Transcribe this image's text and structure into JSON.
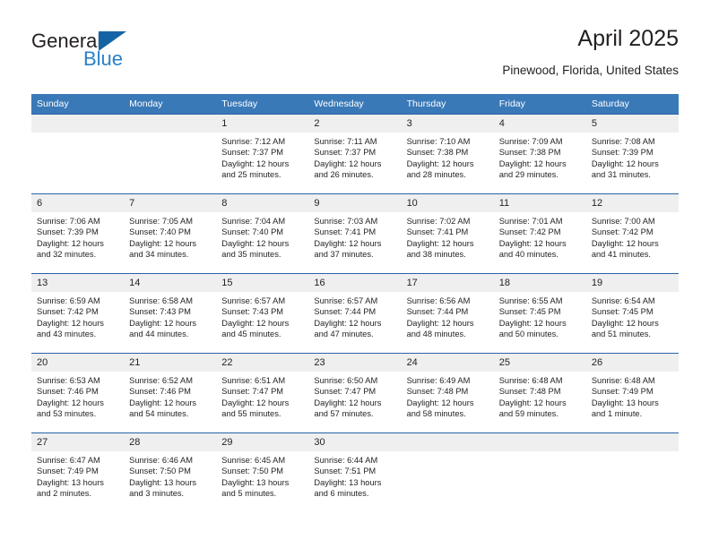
{
  "branding": {
    "logo_primary": "General",
    "logo_secondary": "Blue",
    "accent_color": "#2a7fc9",
    "triangle_color": "#1464a5"
  },
  "header": {
    "title": "April 2025",
    "subtitle": "Pinewood, Florida, United States"
  },
  "calendar": {
    "header_bg": "#3a79b8",
    "row_divider_color": "#2a62a8",
    "daynum_bg": "#efefef",
    "weekday_headers": [
      "Sunday",
      "Monday",
      "Tuesday",
      "Wednesday",
      "Thursday",
      "Friday",
      "Saturday"
    ],
    "weeks": [
      [
        {
          "day": "",
          "empty": true
        },
        {
          "day": "",
          "empty": true
        },
        {
          "day": "1",
          "sunrise": "Sunrise: 7:12 AM",
          "sunset": "Sunset: 7:37 PM",
          "daylight": "Daylight: 12 hours and 25 minutes."
        },
        {
          "day": "2",
          "sunrise": "Sunrise: 7:11 AM",
          "sunset": "Sunset: 7:37 PM",
          "daylight": "Daylight: 12 hours and 26 minutes."
        },
        {
          "day": "3",
          "sunrise": "Sunrise: 7:10 AM",
          "sunset": "Sunset: 7:38 PM",
          "daylight": "Daylight: 12 hours and 28 minutes."
        },
        {
          "day": "4",
          "sunrise": "Sunrise: 7:09 AM",
          "sunset": "Sunset: 7:38 PM",
          "daylight": "Daylight: 12 hours and 29 minutes."
        },
        {
          "day": "5",
          "sunrise": "Sunrise: 7:08 AM",
          "sunset": "Sunset: 7:39 PM",
          "daylight": "Daylight: 12 hours and 31 minutes."
        }
      ],
      [
        {
          "day": "6",
          "sunrise": "Sunrise: 7:06 AM",
          "sunset": "Sunset: 7:39 PM",
          "daylight": "Daylight: 12 hours and 32 minutes."
        },
        {
          "day": "7",
          "sunrise": "Sunrise: 7:05 AM",
          "sunset": "Sunset: 7:40 PM",
          "daylight": "Daylight: 12 hours and 34 minutes."
        },
        {
          "day": "8",
          "sunrise": "Sunrise: 7:04 AM",
          "sunset": "Sunset: 7:40 PM",
          "daylight": "Daylight: 12 hours and 35 minutes."
        },
        {
          "day": "9",
          "sunrise": "Sunrise: 7:03 AM",
          "sunset": "Sunset: 7:41 PM",
          "daylight": "Daylight: 12 hours and 37 minutes."
        },
        {
          "day": "10",
          "sunrise": "Sunrise: 7:02 AM",
          "sunset": "Sunset: 7:41 PM",
          "daylight": "Daylight: 12 hours and 38 minutes."
        },
        {
          "day": "11",
          "sunrise": "Sunrise: 7:01 AM",
          "sunset": "Sunset: 7:42 PM",
          "daylight": "Daylight: 12 hours and 40 minutes."
        },
        {
          "day": "12",
          "sunrise": "Sunrise: 7:00 AM",
          "sunset": "Sunset: 7:42 PM",
          "daylight": "Daylight: 12 hours and 41 minutes."
        }
      ],
      [
        {
          "day": "13",
          "sunrise": "Sunrise: 6:59 AM",
          "sunset": "Sunset: 7:42 PM",
          "daylight": "Daylight: 12 hours and 43 minutes."
        },
        {
          "day": "14",
          "sunrise": "Sunrise: 6:58 AM",
          "sunset": "Sunset: 7:43 PM",
          "daylight": "Daylight: 12 hours and 44 minutes."
        },
        {
          "day": "15",
          "sunrise": "Sunrise: 6:57 AM",
          "sunset": "Sunset: 7:43 PM",
          "daylight": "Daylight: 12 hours and 45 minutes."
        },
        {
          "day": "16",
          "sunrise": "Sunrise: 6:57 AM",
          "sunset": "Sunset: 7:44 PM",
          "daylight": "Daylight: 12 hours and 47 minutes."
        },
        {
          "day": "17",
          "sunrise": "Sunrise: 6:56 AM",
          "sunset": "Sunset: 7:44 PM",
          "daylight": "Daylight: 12 hours and 48 minutes."
        },
        {
          "day": "18",
          "sunrise": "Sunrise: 6:55 AM",
          "sunset": "Sunset: 7:45 PM",
          "daylight": "Daylight: 12 hours and 50 minutes."
        },
        {
          "day": "19",
          "sunrise": "Sunrise: 6:54 AM",
          "sunset": "Sunset: 7:45 PM",
          "daylight": "Daylight: 12 hours and 51 minutes."
        }
      ],
      [
        {
          "day": "20",
          "sunrise": "Sunrise: 6:53 AM",
          "sunset": "Sunset: 7:46 PM",
          "daylight": "Daylight: 12 hours and 53 minutes."
        },
        {
          "day": "21",
          "sunrise": "Sunrise: 6:52 AM",
          "sunset": "Sunset: 7:46 PM",
          "daylight": "Daylight: 12 hours and 54 minutes."
        },
        {
          "day": "22",
          "sunrise": "Sunrise: 6:51 AM",
          "sunset": "Sunset: 7:47 PM",
          "daylight": "Daylight: 12 hours and 55 minutes."
        },
        {
          "day": "23",
          "sunrise": "Sunrise: 6:50 AM",
          "sunset": "Sunset: 7:47 PM",
          "daylight": "Daylight: 12 hours and 57 minutes."
        },
        {
          "day": "24",
          "sunrise": "Sunrise: 6:49 AM",
          "sunset": "Sunset: 7:48 PM",
          "daylight": "Daylight: 12 hours and 58 minutes."
        },
        {
          "day": "25",
          "sunrise": "Sunrise: 6:48 AM",
          "sunset": "Sunset: 7:48 PM",
          "daylight": "Daylight: 12 hours and 59 minutes."
        },
        {
          "day": "26",
          "sunrise": "Sunrise: 6:48 AM",
          "sunset": "Sunset: 7:49 PM",
          "daylight": "Daylight: 13 hours and 1 minute."
        }
      ],
      [
        {
          "day": "27",
          "sunrise": "Sunrise: 6:47 AM",
          "sunset": "Sunset: 7:49 PM",
          "daylight": "Daylight: 13 hours and 2 minutes."
        },
        {
          "day": "28",
          "sunrise": "Sunrise: 6:46 AM",
          "sunset": "Sunset: 7:50 PM",
          "daylight": "Daylight: 13 hours and 3 minutes."
        },
        {
          "day": "29",
          "sunrise": "Sunrise: 6:45 AM",
          "sunset": "Sunset: 7:50 PM",
          "daylight": "Daylight: 13 hours and 5 minutes."
        },
        {
          "day": "30",
          "sunrise": "Sunrise: 6:44 AM",
          "sunset": "Sunset: 7:51 PM",
          "daylight": "Daylight: 13 hours and 6 minutes."
        },
        {
          "day": "",
          "empty": true
        },
        {
          "day": "",
          "empty": true
        },
        {
          "day": "",
          "empty": true
        }
      ]
    ]
  }
}
